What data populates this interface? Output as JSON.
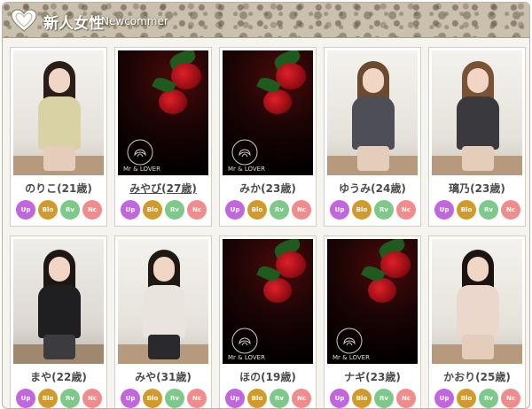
{
  "header": {
    "title": "新人女性",
    "subtitle": "Newcommer"
  },
  "badges": {
    "up": "Up",
    "blo": "Blo",
    "rv": "Rv",
    "nc": "Nc"
  },
  "colors": {
    "up": "#c266e0",
    "blo": "#d29a2a",
    "rv": "#7dc98a",
    "nc": "#f28c8c"
  },
  "cards": [
    {
      "name": "のりこ(21歳)",
      "photo": "studio"
    },
    {
      "name": "みやび(27歳)",
      "photo": "rose-placeholder"
    },
    {
      "name": "みか(23歳)",
      "photo": "rose-placeholder"
    },
    {
      "name": "ゆうみ(24歳)",
      "photo": "studio"
    },
    {
      "name": "璃乃(23歳)",
      "photo": "studio"
    },
    {
      "name": "まや(22歳)",
      "photo": "studio"
    },
    {
      "name": "みや(31歳)",
      "photo": "studio"
    },
    {
      "name": "ほの(19歳)",
      "photo": "rose-placeholder"
    },
    {
      "name": "ナギ(23歳)",
      "photo": "rose-placeholder"
    },
    {
      "name": "かおり(25歳)",
      "photo": "studio"
    }
  ],
  "placeholder_logo_text": "Mr & LOVER"
}
